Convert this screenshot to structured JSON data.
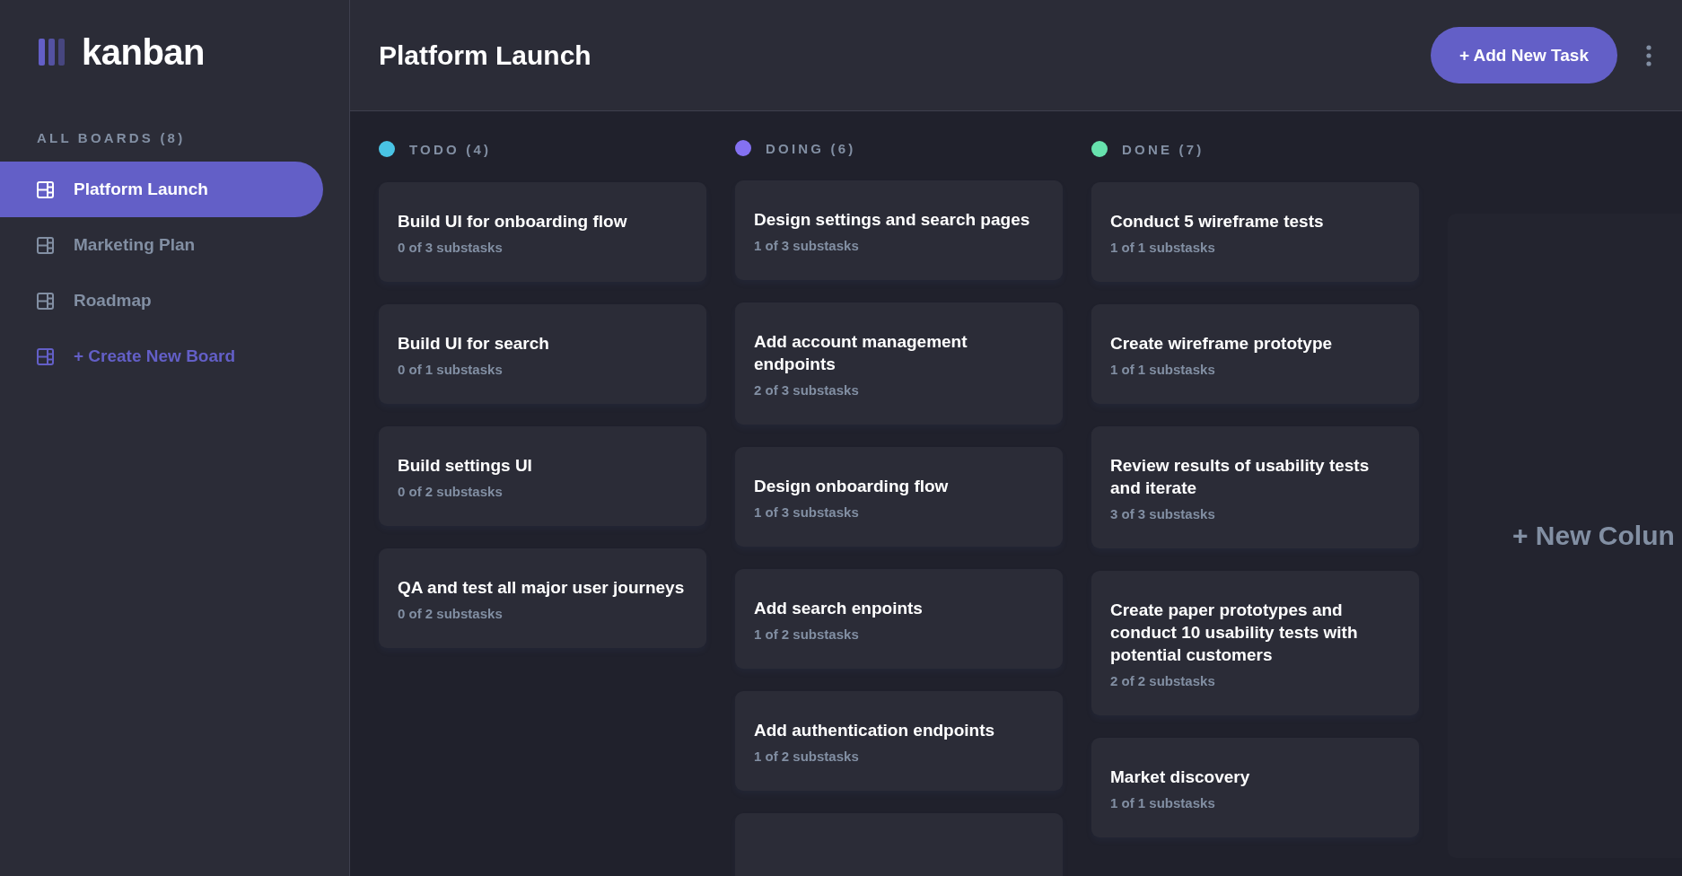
{
  "logo": {
    "text": "kanban"
  },
  "sidebar": {
    "heading": "ALL BOARDS (8)",
    "items": [
      {
        "label": "Platform Launch",
        "selected": true,
        "kind": "board"
      },
      {
        "label": "Marketing Plan",
        "selected": false,
        "kind": "board"
      },
      {
        "label": "Roadmap",
        "selected": false,
        "kind": "board"
      },
      {
        "label": "+ Create New Board",
        "selected": false,
        "kind": "create"
      }
    ]
  },
  "header": {
    "title": "Platform Launch",
    "add_button": "+ Add New Task"
  },
  "columns": [
    {
      "name": "TODO (4)",
      "color": "#49c4e5",
      "cards": [
        {
          "title": "Build UI for onboarding flow",
          "subtasks": "0 of 3 substasks"
        },
        {
          "title": "Build UI for search",
          "subtasks": "0 of 1 substasks"
        },
        {
          "title": "Build settings UI",
          "subtasks": "0 of 2 substasks"
        },
        {
          "title": "QA and test all major user journeys",
          "subtasks": "0 of 2 substasks"
        }
      ]
    },
    {
      "name": "DOING (6)",
      "color": "#8471f2",
      "cards": [
        {
          "title": "Design settings and search pages",
          "subtasks": "1 of 3 substasks"
        },
        {
          "title": "Add account management endpoints",
          "subtasks": "2 of 3 substasks"
        },
        {
          "title": "Design onboarding flow",
          "subtasks": "1 of 3 substasks"
        },
        {
          "title": "Add search enpoints",
          "subtasks": "1 of 2 substasks"
        },
        {
          "title": "Add authentication endpoints",
          "subtasks": "1 of 2 substasks"
        },
        {
          "kind": "cut"
        }
      ]
    },
    {
      "name": "DONE (7)",
      "color": "#67e2ae",
      "cards": [
        {
          "title": "Conduct 5 wireframe tests",
          "subtasks": "1 of 1 substasks"
        },
        {
          "title": "Create wireframe prototype",
          "subtasks": "1 of 1 substasks"
        },
        {
          "title": "Review results of usability tests and iterate",
          "subtasks": "3 of 3 substasks"
        },
        {
          "title": "Create paper prototypes and conduct 10 usability tests with potential customers",
          "subtasks": "2 of 2 substasks"
        },
        {
          "title": "Market discovery",
          "subtasks": "1 of 1 substasks"
        }
      ]
    }
  ],
  "new_column": {
    "label": "+ New Colun"
  }
}
